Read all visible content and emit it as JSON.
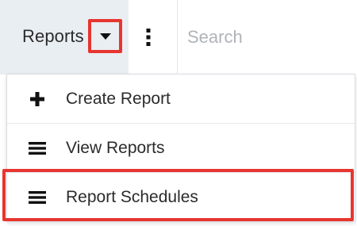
{
  "topbar": {
    "reports_label": "Reports",
    "caret_icon": "caret-down-icon",
    "more_icon": "kebab-vertical-icon",
    "search_placeholder": "Search"
  },
  "menu": {
    "items": [
      {
        "label": "Create Report",
        "icon": "plus-icon"
      },
      {
        "label": "View Reports",
        "icon": "list-icon"
      },
      {
        "label": "Report Schedules",
        "icon": "list-icon"
      }
    ]
  },
  "colors": {
    "highlight": "#e8352f",
    "tab_background": "#e9eef2"
  }
}
